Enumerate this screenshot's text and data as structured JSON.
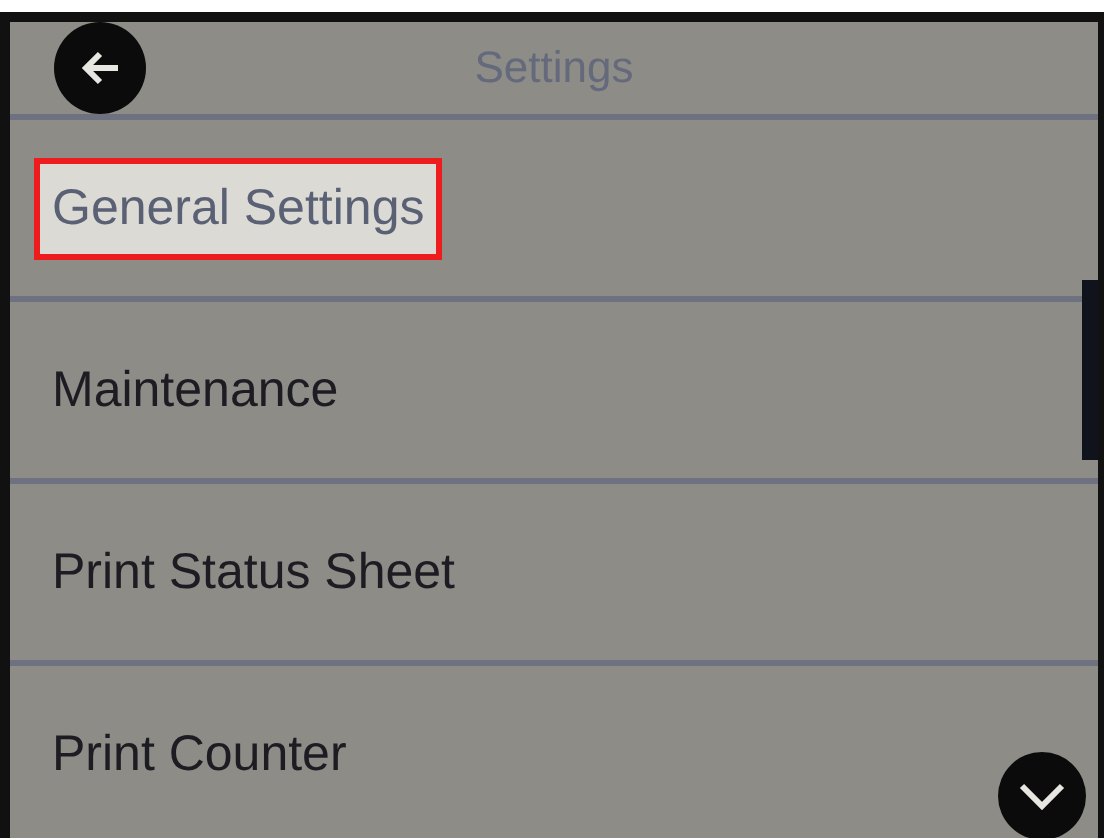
{
  "header": {
    "title": "Settings"
  },
  "items": [
    {
      "label": "General Settings",
      "selected": true
    },
    {
      "label": "Maintenance",
      "selected": false
    },
    {
      "label": "Print Status Sheet",
      "selected": false
    },
    {
      "label": "Print Counter",
      "selected": false
    }
  ]
}
